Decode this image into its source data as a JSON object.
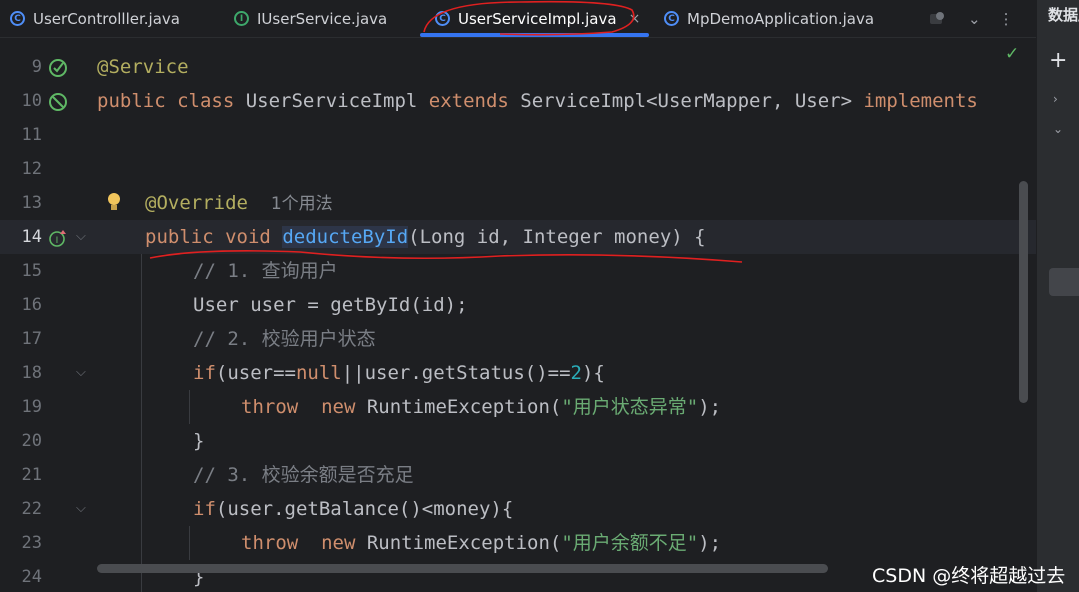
{
  "tabs": [
    {
      "label": "UserControlller.java",
      "icon": "class-icon",
      "icon_glyph": "C",
      "active": false
    },
    {
      "label": "IUserService.java",
      "icon": "interface-icon",
      "icon_glyph": "I",
      "active": false
    },
    {
      "label": "UserServiceImpl.java",
      "icon": "class-icon",
      "icon_glyph": "C",
      "active": true,
      "close": "×"
    },
    {
      "label": "MpDemoApplication.java",
      "icon": "spring-class-icon",
      "icon_glyph": "C",
      "active": false
    }
  ],
  "tab_tools": {
    "dropdown": "⌄",
    "more": "⋮"
  },
  "sidebar": {
    "title": "数据库",
    "plus": "+"
  },
  "editor": {
    "lines": [
      {
        "num": "9"
      },
      {
        "num": "10"
      },
      {
        "num": "11"
      },
      {
        "num": "12"
      },
      {
        "num": "13"
      },
      {
        "num": "14"
      },
      {
        "num": "15"
      },
      {
        "num": "16"
      },
      {
        "num": "17"
      },
      {
        "num": "18"
      },
      {
        "num": "19"
      },
      {
        "num": "20"
      },
      {
        "num": "21"
      },
      {
        "num": "22"
      },
      {
        "num": "23"
      },
      {
        "num": "24"
      }
    ],
    "code": {
      "l9_annotation": "@Service",
      "l10_public": "public",
      "l10_class": "class",
      "l10_name": " UserServiceImpl ",
      "l10_extends": "extends",
      "l10_super": " ServiceImpl<UserMapper, User> ",
      "l10_implements": "implements",
      "l13_annotation": "@Override",
      "l13_hint": "1个用法",
      "l14_public": "public",
      "l14_void": "void",
      "l14_method": "deducteById",
      "l14_params": "(Long id, Integer money) {",
      "l15_comment": "// 1. 查询用户",
      "l16_code": "User user = getById(id);",
      "l17_comment": "// 2. 校验用户状态",
      "l18_if": "if",
      "l18_a": "(user==",
      "l18_null": "null",
      "l18_b": "||user.getStatus()==",
      "l18_num": "2",
      "l18_c": "){",
      "l19_throw": "throw",
      "l19_new": "new",
      "l19_ex": " RuntimeException(",
      "l19_str": "\"用户状态异常\"",
      "l19_end": ");",
      "l20_brace": "}",
      "l21_comment": "// 3. 校验余额是否充足",
      "l22_if": "if",
      "l22_rest": "(user.getBalance()<money){",
      "l23_throw": "throw",
      "l23_new": "new",
      "l23_ex": " RuntimeException(",
      "l23_str": "\"用户余额不足\"",
      "l23_end": ");",
      "l24_brace": "}"
    }
  },
  "status": {
    "check": "✓"
  },
  "watermark": "CSDN @终将超越过去",
  "colors": {
    "keyword": "#cf8e6d",
    "annotation": "#b3ae60",
    "method": "#56a8f5",
    "string": "#6aab73",
    "comment": "#7a7e85",
    "number": "#2aacb8",
    "accent": "#3574f0",
    "annotation_ink": "#e02020"
  }
}
